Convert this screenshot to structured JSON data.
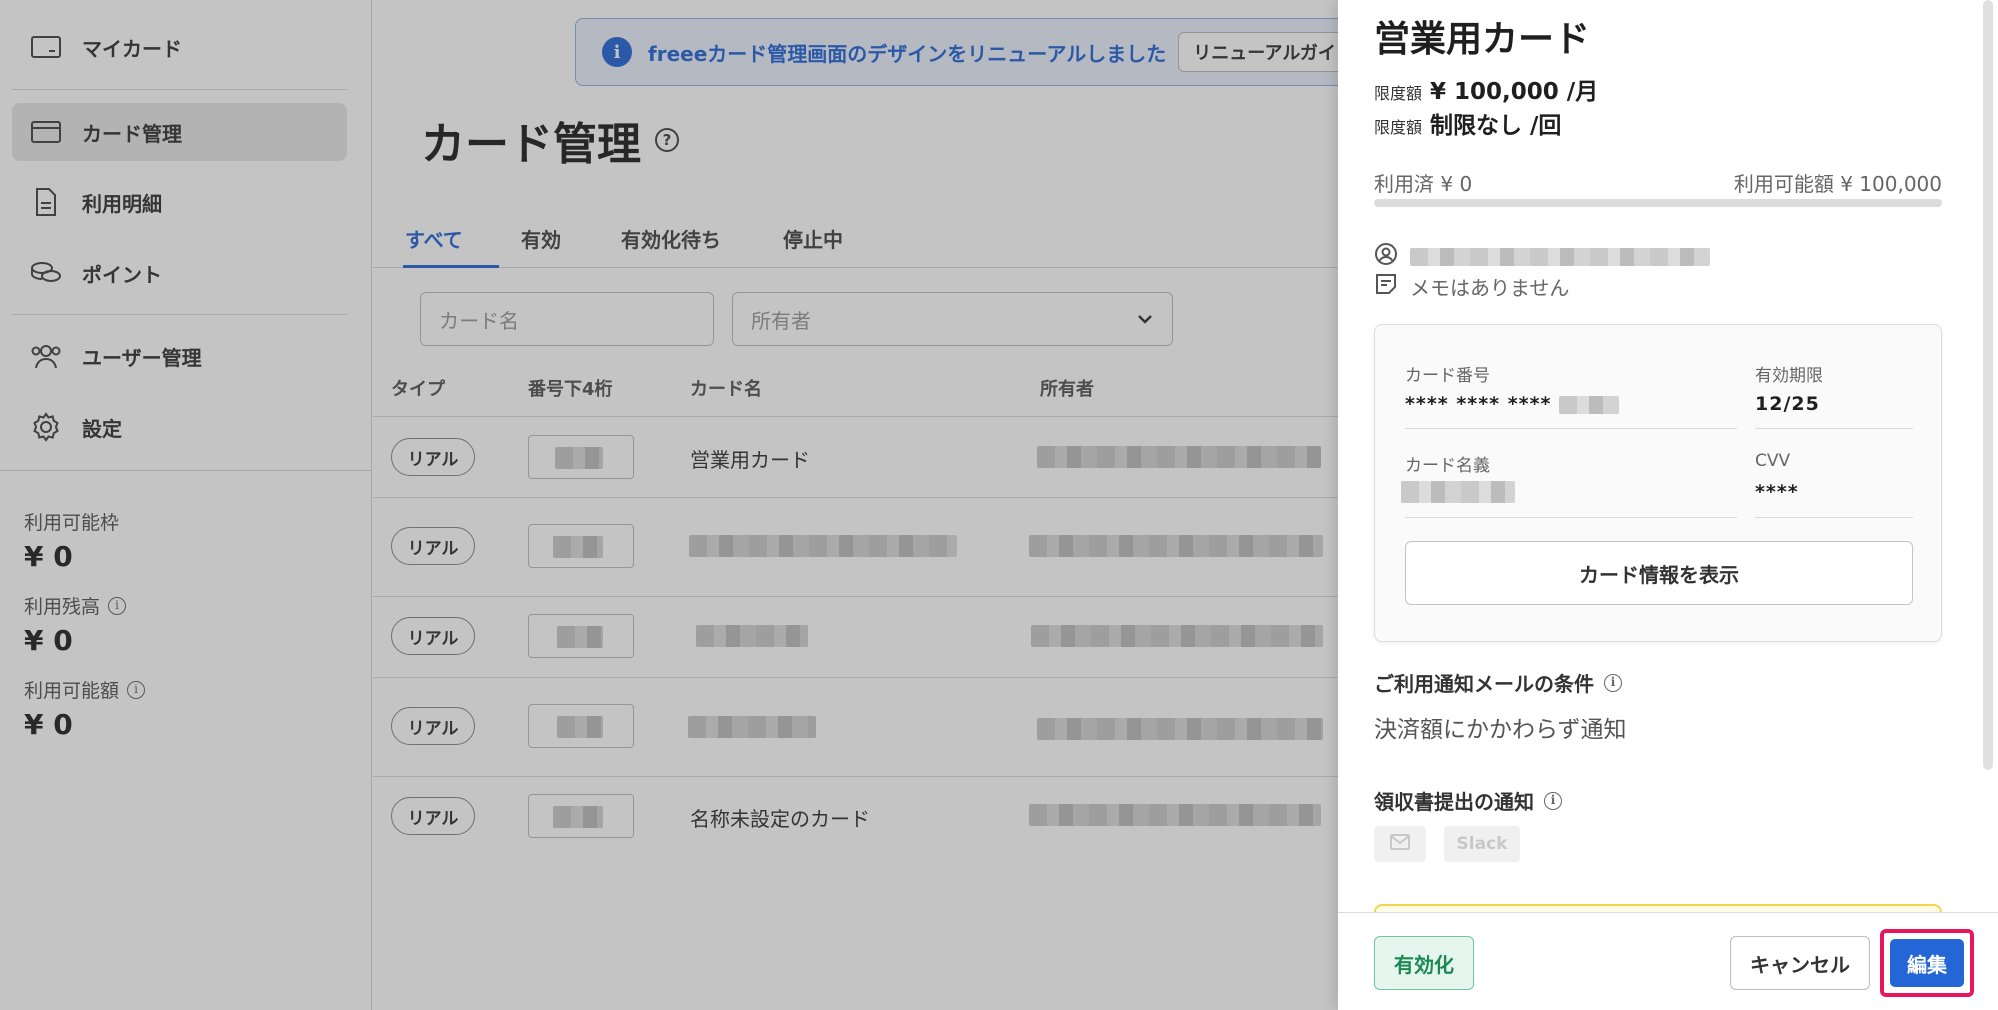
{
  "sidebar": {
    "items": [
      {
        "label": "マイカード",
        "icon": "credit-card-icon"
      },
      {
        "label": "カード管理",
        "icon": "card-stack-icon"
      },
      {
        "label": "利用明細",
        "icon": "document-icon"
      },
      {
        "label": "ポイント",
        "icon": "coins-icon"
      },
      {
        "label": "ユーザー管理",
        "icon": "users-icon"
      },
      {
        "label": "設定",
        "icon": "gear-icon"
      }
    ],
    "stats": [
      {
        "label": "利用可能枠",
        "value": "¥ 0",
        "info": false
      },
      {
        "label": "利用残高",
        "value": "¥ 0",
        "info": true
      },
      {
        "label": "利用可能額",
        "value": "¥ 0",
        "info": true
      }
    ]
  },
  "banner": {
    "text": "freeeカード管理画面のデザインをリニューアルしました",
    "button": "リニューアルガイ"
  },
  "page": {
    "title": "カード管理",
    "tabs": [
      "すべて",
      "有効",
      "有効化待ち",
      "停止中"
    ],
    "filters": {
      "card_name_placeholder": "カード名",
      "owner_placeholder": "所有者"
    },
    "columns": [
      "タイプ",
      "番号下4桁",
      "カード名",
      "所有者"
    ],
    "rows": [
      {
        "type": "リアル",
        "name": "営業用カード"
      },
      {
        "type": "リアル",
        "name": ""
      },
      {
        "type": "リアル",
        "name": ""
      },
      {
        "type": "リアル",
        "name": ""
      },
      {
        "type": "リアル",
        "name": "名称未設定のカード"
      }
    ]
  },
  "drawer": {
    "title": "営業用カード",
    "limits": [
      {
        "label": "限度額",
        "value": "¥ 100,000 /月"
      },
      {
        "label": "限度額",
        "value": "制限なし /回"
      }
    ],
    "used": "利用済 ¥ 0",
    "available": "利用可能額 ¥ 100,000",
    "usage_fraction": 0,
    "memo": "メモはありません",
    "card": {
      "number_label": "カード番号",
      "number_value": "**** **** ****",
      "expiry_label": "有効期限",
      "expiry_value": "12/25",
      "holder_label": "カード名義",
      "cvv_label": "CVV",
      "cvv_value": "****",
      "show_button": "カード情報を表示"
    },
    "notify_title": "ご利用通知メールの条件",
    "notify_text": "決済額にかかわらず通知",
    "receipt_title": "領収書提出の通知",
    "receipt_chips": [
      "",
      "Slack"
    ],
    "footer": {
      "activate": "有効化",
      "cancel": "キャンセル",
      "edit": "編集"
    }
  },
  "colors": {
    "accent": "#2566d7",
    "highlight": "#e8175d",
    "success": "#1a8a54"
  }
}
